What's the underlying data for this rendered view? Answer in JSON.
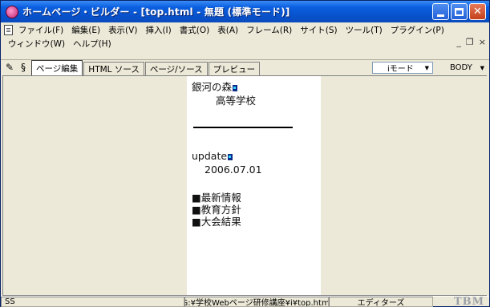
{
  "window": {
    "title": "ホームページ・ビルダー - [top.html - 無題 (標準モード)]"
  },
  "menubar": {
    "row1": [
      "ファイル(F)",
      "編集(E)",
      "表示(V)",
      "挿入(I)",
      "書式(O)",
      "表(A)",
      "フレーム(R)",
      "サイト(S)",
      "ツール(T)",
      "プラグイン(P)"
    ],
    "row2": [
      "ウィンドウ(W)",
      "ヘルプ(H)"
    ]
  },
  "tabs": {
    "items": [
      "ページ編集",
      "HTML ソース",
      "ページ/ソース",
      "プレビュー"
    ],
    "active_index": 0,
    "mode_value": "iモード",
    "tag_value": "BODY"
  },
  "page_content": {
    "line1": "銀河の森",
    "line2": "高等学校",
    "update_label": "update",
    "date": "2006.07.01",
    "menu_items": [
      "■最新情報",
      "■教育方針",
      "■大会結果"
    ]
  },
  "status": {
    "left": "SS",
    "path": "G:¥学校Webページ研修講座¥i¥top.html",
    "editor": "エディターズ",
    "logo": "TBM"
  }
}
